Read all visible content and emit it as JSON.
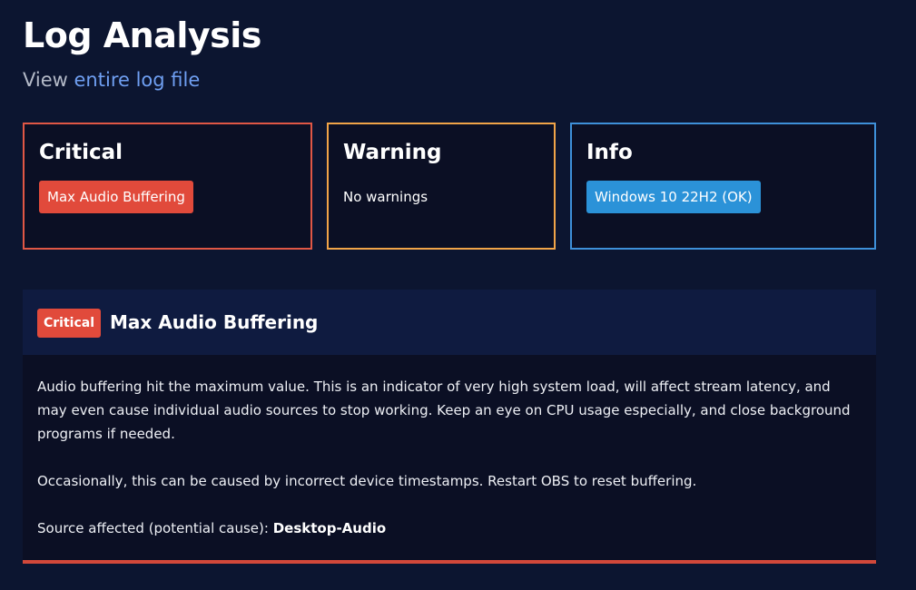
{
  "header": {
    "title": "Log Analysis",
    "view_prefix": "View ",
    "view_link": "entire log file"
  },
  "summary": {
    "critical": {
      "title": "Critical",
      "items": [
        "Max Audio Buffering"
      ],
      "color": "#e05745"
    },
    "warning": {
      "title": "Warning",
      "empty_text": "No warnings",
      "color": "#f1a448"
    },
    "info": {
      "title": "Info",
      "items": [
        "Windows 10 22H2 (OK)"
      ],
      "color": "#3e90d9"
    }
  },
  "detail": {
    "severity": "Critical",
    "title": "Max Audio Buffering",
    "paragraphs": [
      "Audio buffering hit the maximum value. This is an indicator of very high system load, will affect stream latency, and may even cause individual audio sources to stop working. Keep an eye on CPU usage especially, and close background programs if needed.",
      "Occasionally, this can be caused by incorrect device timestamps. Restart OBS to reset buffering."
    ],
    "source_label": "Source affected (potential cause): ",
    "source_value": "Desktop-Audio",
    "accent_color": "#d2483a"
  }
}
